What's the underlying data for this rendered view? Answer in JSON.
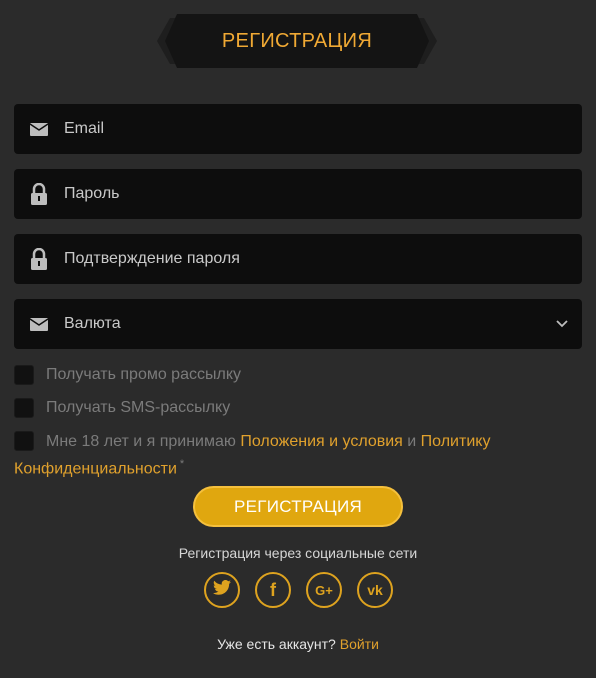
{
  "header": {
    "title": "РЕГИСТРАЦИЯ"
  },
  "form": {
    "email_placeholder": "Email",
    "password_placeholder": "Пароль",
    "confirm_placeholder": "Подтверждение пароля",
    "currency_placeholder": "Валюта"
  },
  "checkboxes": {
    "promo": "Получать промо рассылку",
    "sms": "Получать SMS-рассылку",
    "terms_prefix": "Мне 18 лет и я принимаю",
    "terms_link": "Положения и условия",
    "and": "и",
    "privacy_link": "Политику Конфиденциальности",
    "asterisk": "*"
  },
  "register_button": "РЕГИСТРАЦИЯ",
  "social": {
    "title": "Регистрация через социальные сети",
    "networks": [
      "twitter",
      "facebook",
      "google-plus",
      "vk"
    ],
    "google_label": "G+",
    "vk_label": "vk",
    "facebook_label": "f"
  },
  "footer": {
    "question": "Уже есть аккаунт?",
    "login_link": "Войти"
  },
  "colors": {
    "accent": "#e0a12d",
    "button": "#e0a70f",
    "background": "#2b2b2b",
    "field": "#0d0d0d"
  }
}
